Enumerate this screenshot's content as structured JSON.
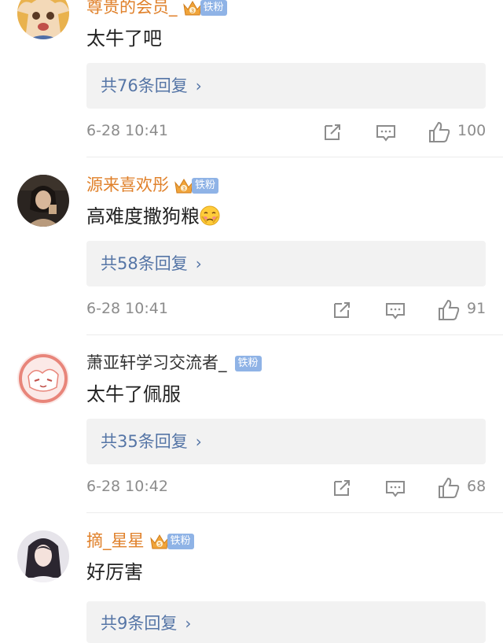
{
  "comments": [
    {
      "username": "尊贵的会员_",
      "fan_badge": "铁粉",
      "text": "太牛了吧",
      "replies": "共76条回复",
      "time": "6-28 10:41",
      "likes": "100"
    },
    {
      "username": "源来喜欢彤",
      "fan_badge": "铁粉",
      "text": "高难度撒狗粮",
      "replies": "共58条回复",
      "time": "6-28 10:41",
      "likes": "91"
    },
    {
      "username": "萧亚轩学习交流者_",
      "fan_badge": "铁粉",
      "text": "太牛了佩服",
      "replies": "共35条回复",
      "time": "6-28 10:42",
      "likes": "68"
    },
    {
      "username": "摘_星星",
      "fan_badge": "铁粉",
      "text": "好厉害",
      "replies": "共9条回复"
    }
  ],
  "colors": {
    "vip_name": "#e0812b",
    "link": "#5575a6",
    "meta": "#8c8c8c",
    "fan_badge": "#8fb3e6"
  },
  "icons": [
    "crown-icon",
    "repost-icon",
    "comment-icon",
    "like-icon",
    "chevron-right-icon",
    "blush-emoji-icon"
  ]
}
